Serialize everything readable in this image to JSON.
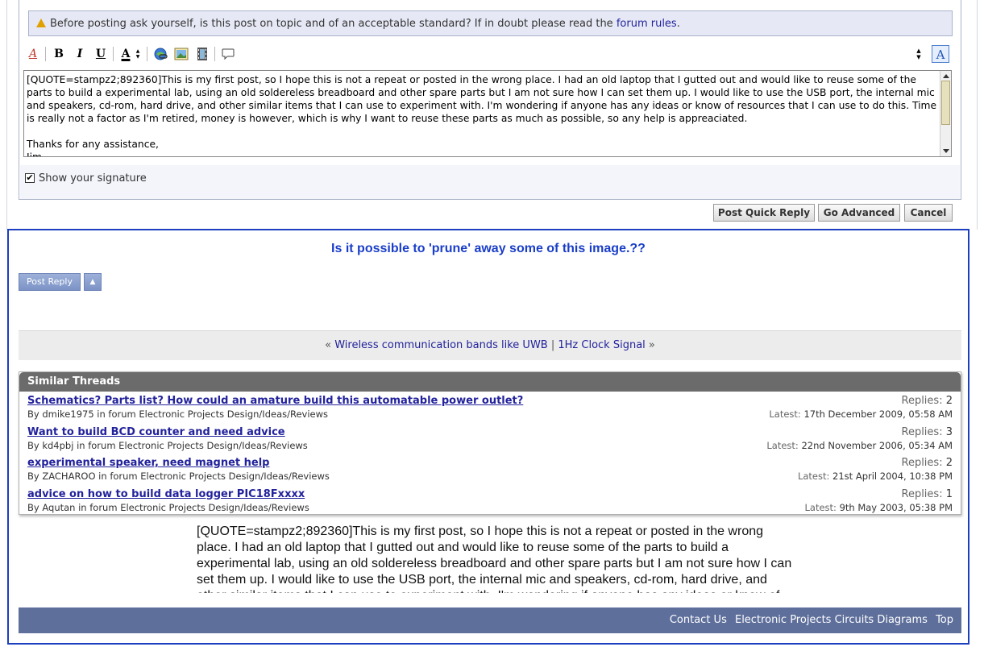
{
  "notice": {
    "text": "Before posting ask yourself, is this post on topic and of an acceptable standard? If in doubt please read the",
    "link": "forum rules",
    "end": "."
  },
  "toolbar": {
    "font_icon": "A",
    "bold": "B",
    "italic": "I",
    "underline": "U",
    "color": "A",
    "color_arrow": "▲▼",
    "resize": "▲▼",
    "switch_mode": "A"
  },
  "editor": {
    "text": "[QUOTE=stampz2;892360]This is my first post, so I hope this is not a repeat or posted in the wrong place. I had an old laptop that I gutted out and would like to reuse some of the parts to build a experimental lab, using an old soldereless breadboard and other spare parts but I am not sure how I can set them up. I would like to use the USB port, the internal mic and speakers, cd-rom, hard drive, and other similar items that I can use to experiment with. I'm wondering if anyone has any ideas or know of resources that I can use to do this. Time is really not a factor as I'm retired, money is however, which is why I want to reuse these parts as much as possible, so any help is appreaciated.\n\nThanks for any assistance,\nJim"
  },
  "signature": {
    "label": "Show your signature",
    "checked": "✔"
  },
  "buttons": {
    "quick_reply": "Post Quick Reply",
    "advanced": "Go Advanced",
    "cancel": "Cancel"
  },
  "question": "Is it possible to 'prune' away some of this image.??",
  "post_reply": "Post Reply",
  "up_arrow": "▲",
  "nav": {
    "prev_mark": "«",
    "prev": "Wireless communication bands like UWB",
    "sep": "|",
    "next": "1Hz Clock Signal",
    "next_mark": "»"
  },
  "similar": {
    "header": "Similar Threads",
    "replies_label": "Replies:",
    "latest_label": "Latest:",
    "threads": [
      {
        "title": "Schematics? Parts list? How could an amature build this automatable power outlet?",
        "by": "By dmike1975 in forum Electronic Projects Design/Ideas/Reviews",
        "replies": "2",
        "latest": "17th December 2009, 05:58 AM"
      },
      {
        "title": "Want to build BCD counter and need advice",
        "by": "By kd4pbj in forum Electronic Projects Design/Ideas/Reviews",
        "replies": "3",
        "latest": "22nd November 2006, 05:34 AM"
      },
      {
        "title": "experimental speaker, need magnet help",
        "by": "By ZACHAROO in forum Electronic Projects Design/Ideas/Reviews",
        "replies": "2",
        "latest": "21st April 2004, 10:38 PM"
      },
      {
        "title": "advice on how to build data logger PIC18Fxxxx",
        "by": "By Aqutan in forum Electronic Projects Design/Ideas/Reviews",
        "replies": "1",
        "latest": "9th May 2003, 05:38 PM"
      }
    ]
  },
  "quote_text": "[QUOTE=stampz2;892360]This is my first post, so I hope this is not a repeat or posted in the wrong place. I had an old laptop that I gutted out and would like to reuse some of the parts to build a experimental lab, using an old soldereless breadboard and other spare parts but I am not sure how I can set them up. I would like to use the USB port, the internal mic and speakers, cd-rom, hard drive, and other similar items that I can use to experiment with. I'm wondering if anyone has any ideas or know of",
  "footer": {
    "contact": "Contact Us",
    "site": "Electronic Projects Circuits Diagrams",
    "top": "Top"
  }
}
